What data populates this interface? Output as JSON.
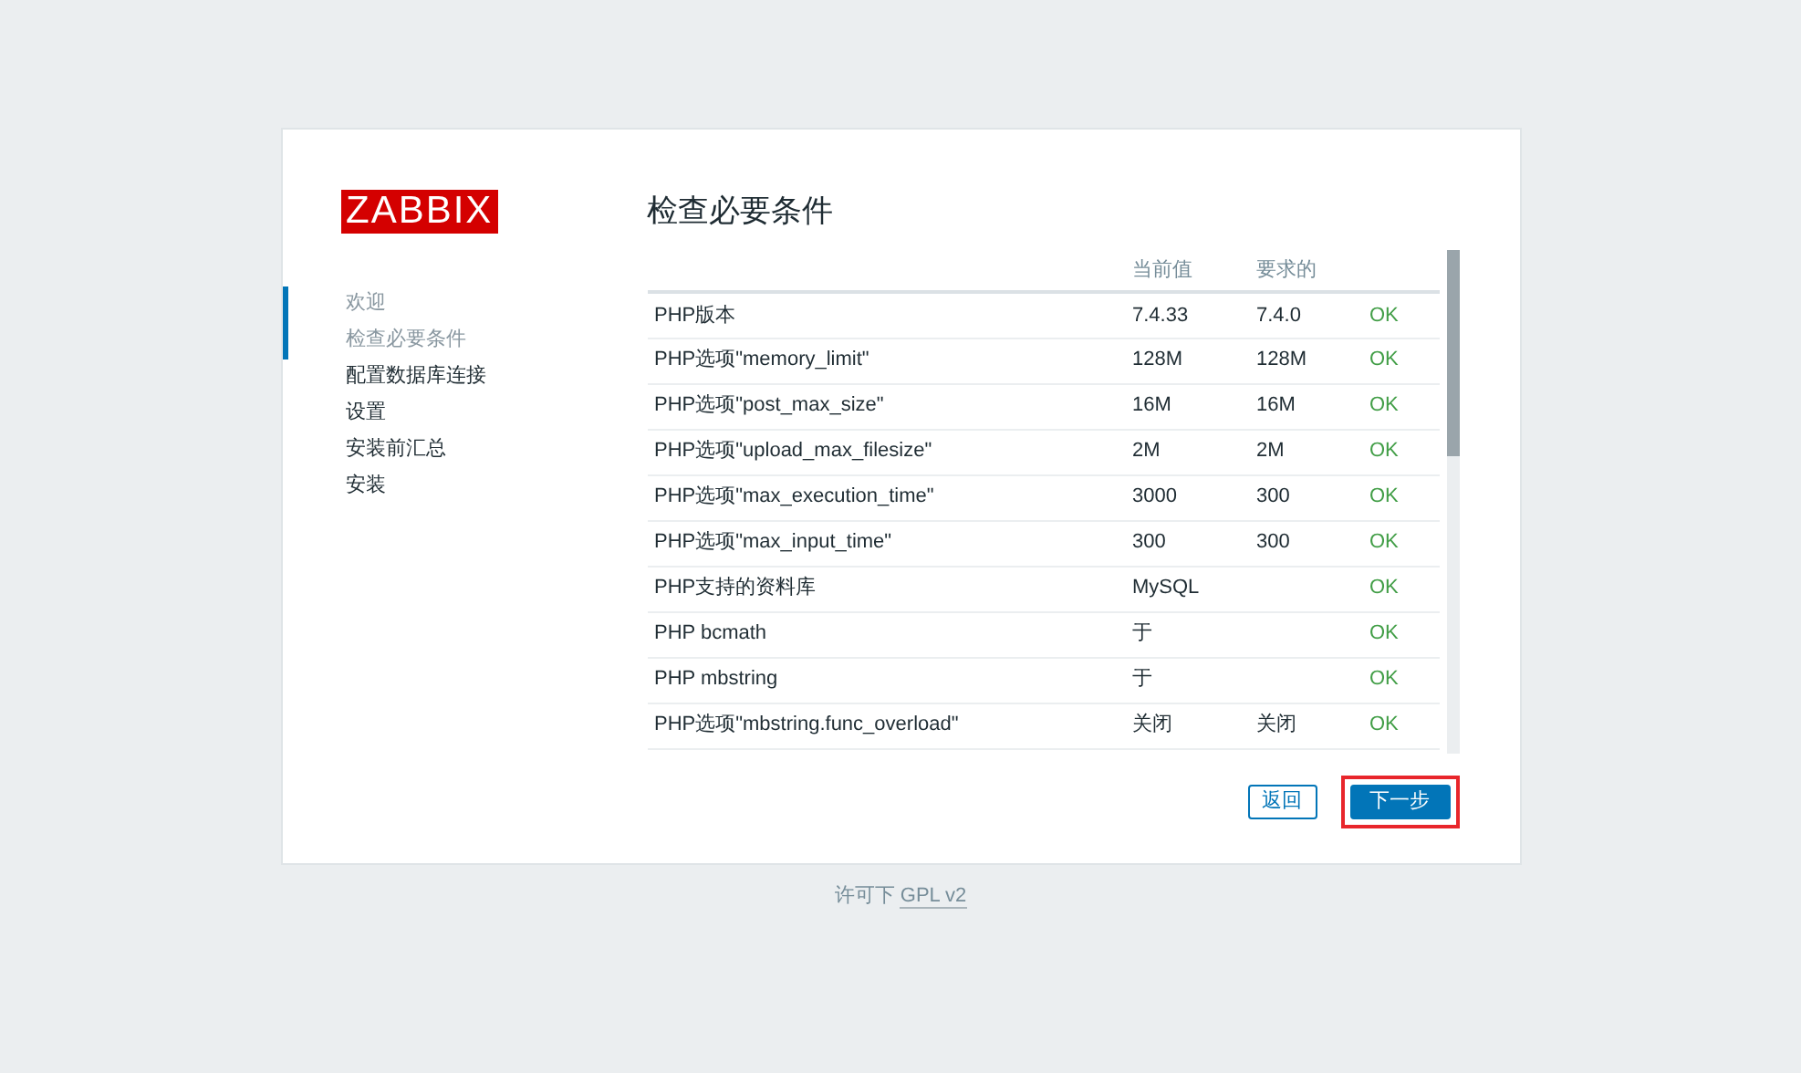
{
  "logo": "ZABBIX",
  "steps": [
    {
      "label": "欢迎",
      "done": true
    },
    {
      "label": "检查必要条件",
      "done": true
    },
    {
      "label": "配置数据库连接",
      "done": false
    },
    {
      "label": "设置",
      "done": false
    },
    {
      "label": "安装前汇总",
      "done": false
    },
    {
      "label": "安装",
      "done": false
    }
  ],
  "title": "检查必要条件",
  "table": {
    "columns": [
      "当前值",
      "要求的"
    ],
    "rows": [
      {
        "name": "PHP版本",
        "current": "7.4.33",
        "required": "7.4.0",
        "result": "OK"
      },
      {
        "name": "PHP选项\"memory_limit\"",
        "current": "128M",
        "required": "128M",
        "result": "OK"
      },
      {
        "name": "PHP选项\"post_max_size\"",
        "current": "16M",
        "required": "16M",
        "result": "OK"
      },
      {
        "name": "PHP选项\"upload_max_filesize\"",
        "current": "2M",
        "required": "2M",
        "result": "OK"
      },
      {
        "name": "PHP选项\"max_execution_time\"",
        "current": "3000",
        "required": "300",
        "result": "OK"
      },
      {
        "name": "PHP选项\"max_input_time\"",
        "current": "300",
        "required": "300",
        "result": "OK"
      },
      {
        "name": "PHP支持的资料库",
        "current": "MySQL",
        "required": "",
        "result": "OK"
      },
      {
        "name": "PHP bcmath",
        "current": "于",
        "required": "",
        "result": "OK"
      },
      {
        "name": "PHP mbstring",
        "current": "于",
        "required": "",
        "result": "OK"
      },
      {
        "name": "PHP选项\"mbstring.func_overload\"",
        "current": "关闭",
        "required": "关闭",
        "result": "OK"
      }
    ]
  },
  "buttons": [
    {
      "label": "返回",
      "kind": "secondary",
      "highlighted": false
    },
    {
      "label": "下一步",
      "kind": "primary",
      "highlighted": true
    }
  ],
  "footer": {
    "prefix": "许可下",
    "link": "GPL v2"
  }
}
